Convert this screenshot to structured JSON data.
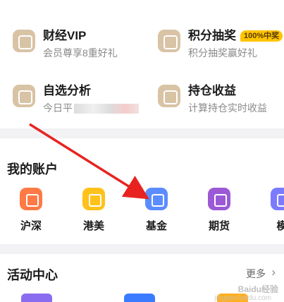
{
  "features": [
    {
      "title": "财经VIP",
      "sub": "会员尊享8重好礼",
      "badge": "",
      "icon": "vip-icon"
    },
    {
      "title": "积分抽奖",
      "sub": "积分抽奖赢好礼",
      "badge": "100%中奖",
      "icon": "lottery-icon"
    },
    {
      "title": "自选分析",
      "sub": "今日平",
      "badge": "",
      "icon": "analysis-icon"
    },
    {
      "title": "持仓收益",
      "sub": "计算持仓实时收益",
      "badge": "",
      "icon": "holdings-icon"
    }
  ],
  "accounts": {
    "title": "我的账户",
    "items": [
      {
        "label": "沪深",
        "color": "#ff7a45",
        "icon": "hushen-icon"
      },
      {
        "label": "港美",
        "color": "#ffc21a",
        "icon": "gangmei-icon"
      },
      {
        "label": "基金",
        "color": "#5b8cff",
        "icon": "fund-icon"
      },
      {
        "label": "期货",
        "color": "#9b59d6",
        "icon": "futures-icon"
      },
      {
        "label": "模",
        "color": "#7b7bff",
        "icon": "simulation-icon"
      }
    ]
  },
  "activity": {
    "title": "活动中心",
    "more": "更多"
  },
  "watermark": {
    "line1": "Baidu经验",
    "line2": "jingyan.baidu.com"
  },
  "colors": {
    "arrow": "#e8231f",
    "feature_icon": "#d8c3a5"
  }
}
